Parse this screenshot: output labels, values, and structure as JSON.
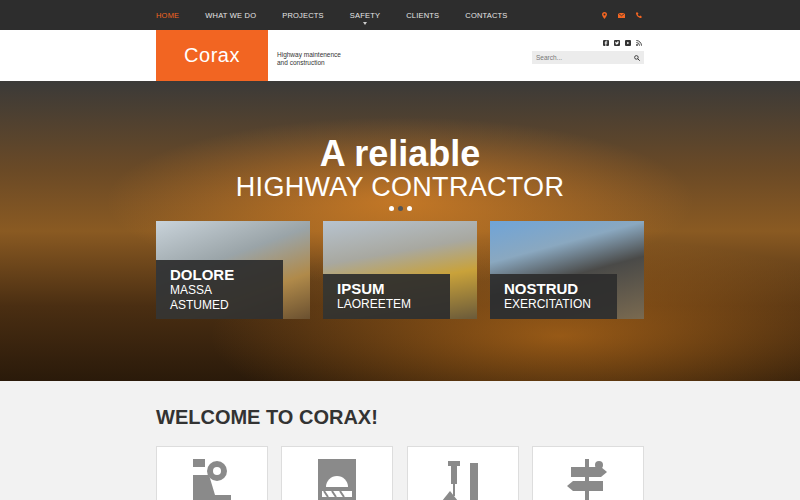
{
  "nav": {
    "items": [
      {
        "label": "HOME",
        "selected": true,
        "has_submenu": false
      },
      {
        "label": "WHAT WE DO",
        "selected": false,
        "has_submenu": false
      },
      {
        "label": "PROJECTS",
        "selected": false,
        "has_submenu": false
      },
      {
        "label": "SAFETY",
        "selected": false,
        "has_submenu": true
      },
      {
        "label": "CLIENTS",
        "selected": false,
        "has_submenu": false
      },
      {
        "label": "CONTACTS",
        "selected": false,
        "has_submenu": false
      }
    ]
  },
  "logo": {
    "text": "Corax"
  },
  "tagline": [
    "Highway maintenence",
    "and construction"
  ],
  "search": {
    "placeholder": "Search..."
  },
  "hero": {
    "title": "A reliable",
    "subtitle": "HIGHWAY CONTRACTOR",
    "dots": [
      {
        "selected": false
      },
      {
        "selected": true
      },
      {
        "selected": false
      }
    ]
  },
  "cards": [
    {
      "title": "DOLORE",
      "subtitle": "MASSA ASTUMED"
    },
    {
      "title": "IPSUM",
      "subtitle": "LAOREETEM"
    },
    {
      "title": "NOSTRUD",
      "subtitle": "EXERCITATION"
    }
  ],
  "welcome": {
    "title": "WELCOME TO CORAX!"
  }
}
